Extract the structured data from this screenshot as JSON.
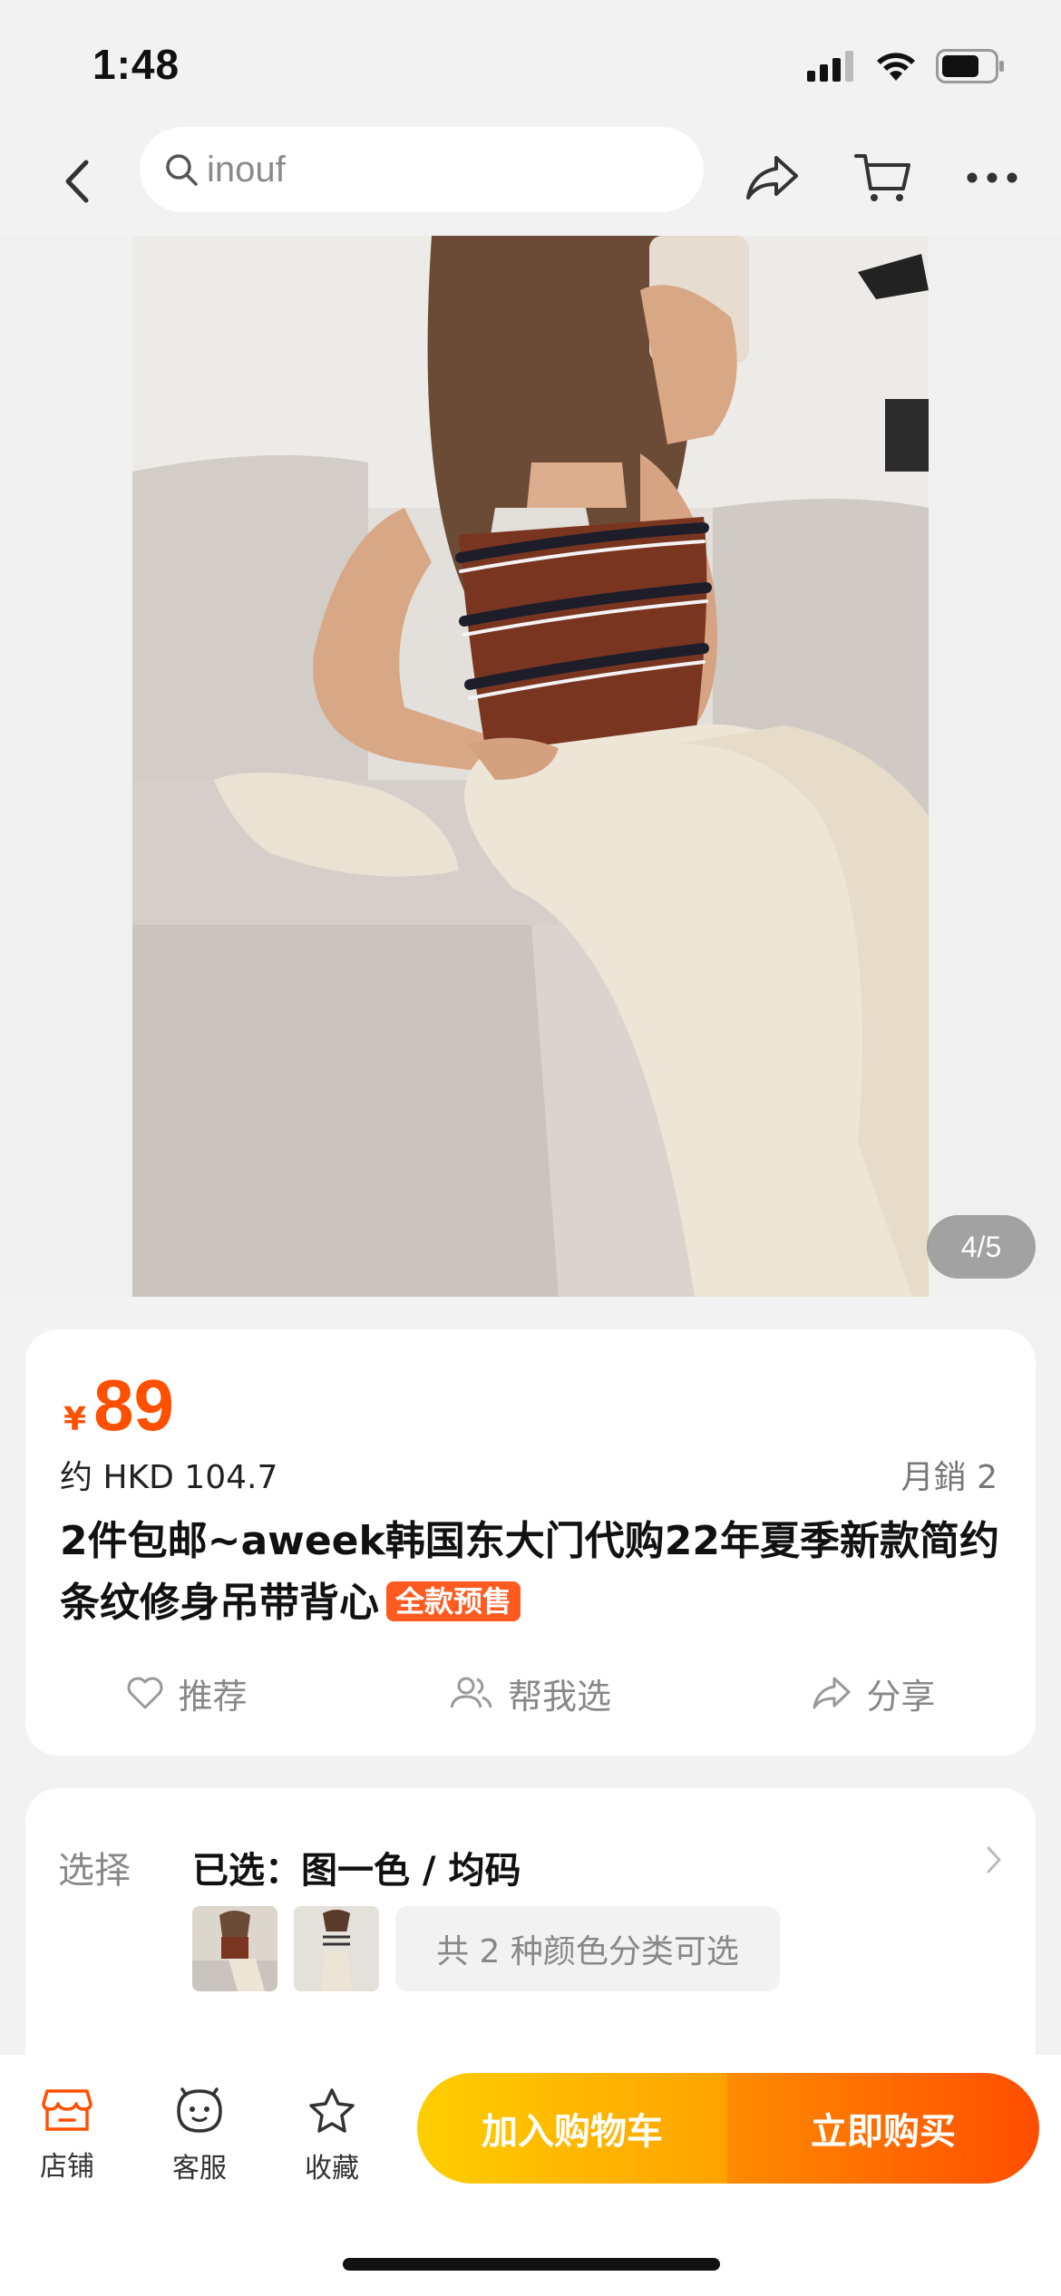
{
  "status_bar": {
    "time": "1:48"
  },
  "search": {
    "query": "inouf"
  },
  "gallery": {
    "counter": "4/5"
  },
  "product": {
    "currency": "¥",
    "price": "89",
    "hkd_price": "约 HKD 104.7",
    "monthly_sales": "月銷 2",
    "title": "2件包邮~aweek韩国东大门代购22年夏季新款简约条纹修身吊带背心",
    "badge": "全款预售"
  },
  "actions": {
    "recommend": "推荐",
    "help_choose": "帮我选",
    "share": "分享"
  },
  "selection": {
    "label": "选择",
    "selected": "已选：图一色 / 均码",
    "color_options_text": "共 2 种颜色分类可选"
  },
  "bottom_bar": {
    "store": "店铺",
    "service": "客服",
    "favorite": "收藏",
    "add_to_cart": "加入购物车",
    "buy_now": "立即购买"
  },
  "colors": {
    "accent": "#ff5000",
    "cart_button": "#ffb300",
    "buy_button": "#ff5a00"
  }
}
